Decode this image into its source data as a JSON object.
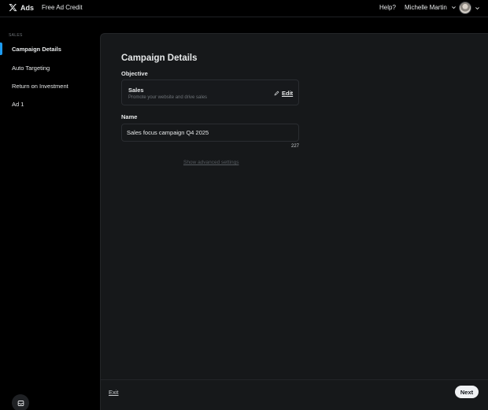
{
  "header": {
    "brand": "Ads",
    "credit_link": "Free Ad Credit",
    "help": "Help?",
    "user_name": "Michelle Martin"
  },
  "sidebar": {
    "heading": "SALES",
    "items": [
      {
        "label": "Campaign Details",
        "active": true
      },
      {
        "label": "Auto Targeting",
        "active": false
      },
      {
        "label": "Return on Investment",
        "active": false
      },
      {
        "label": "Ad 1",
        "active": false
      }
    ]
  },
  "main": {
    "title": "Campaign Details",
    "objective_label": "Objective",
    "objective": {
      "name": "Sales",
      "description": "Promote your website and drive sales",
      "edit_label": "Edit"
    },
    "name_label": "Name",
    "name_value": "Sales focus campaign Q4 2025",
    "char_count": "227",
    "advanced_link": "Show advanced settings",
    "exit_label": "Exit",
    "next_label": "Next"
  },
  "colors": {
    "accent": "#1d9bf0",
    "background": "#000000",
    "panel": "#16181a"
  }
}
